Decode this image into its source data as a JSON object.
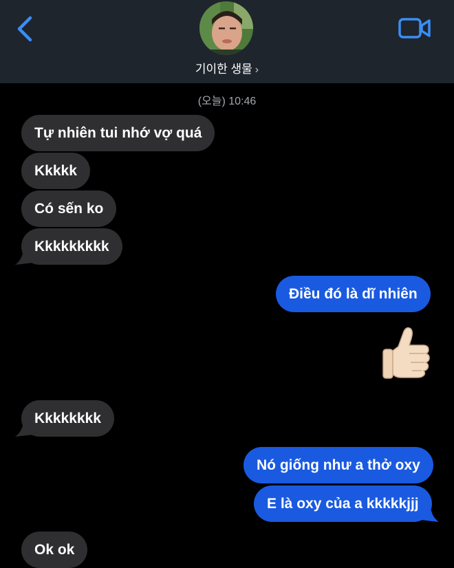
{
  "header": {
    "contact_name": "기이한 생물",
    "chevron": "›",
    "icons": {
      "back": "chevron-left-icon",
      "video": "video-camera-icon"
    },
    "accent_color": "#3a8ef6"
  },
  "timestamp": "(오늘) 10:46",
  "messages": [
    {
      "side": "received",
      "text": "Tự nhiên tui nhớ vợ quá"
    },
    {
      "side": "received",
      "text": "Kkkkk"
    },
    {
      "side": "received",
      "text": "Có sến ko"
    },
    {
      "side": "received",
      "text": "Kkkkkkkkk"
    },
    {
      "side": "sent",
      "text": "Điều đó là dĩ nhiên"
    },
    {
      "side": "sent",
      "emoji": "👍",
      "icon": "thumbs-up-icon"
    },
    {
      "side": "received",
      "text": "Kkkkkkkk"
    },
    {
      "side": "sent",
      "text": "Nó giống như a thở oxy"
    },
    {
      "side": "sent",
      "text": "E là oxy của a kkkkkjjj"
    },
    {
      "side": "received",
      "text": "Ok ok"
    }
  ],
  "colors": {
    "received_bubble": "#2f2f31",
    "sent_bubble": "#1a5ae0",
    "header_bg": "#1f252d",
    "background": "#000000"
  }
}
